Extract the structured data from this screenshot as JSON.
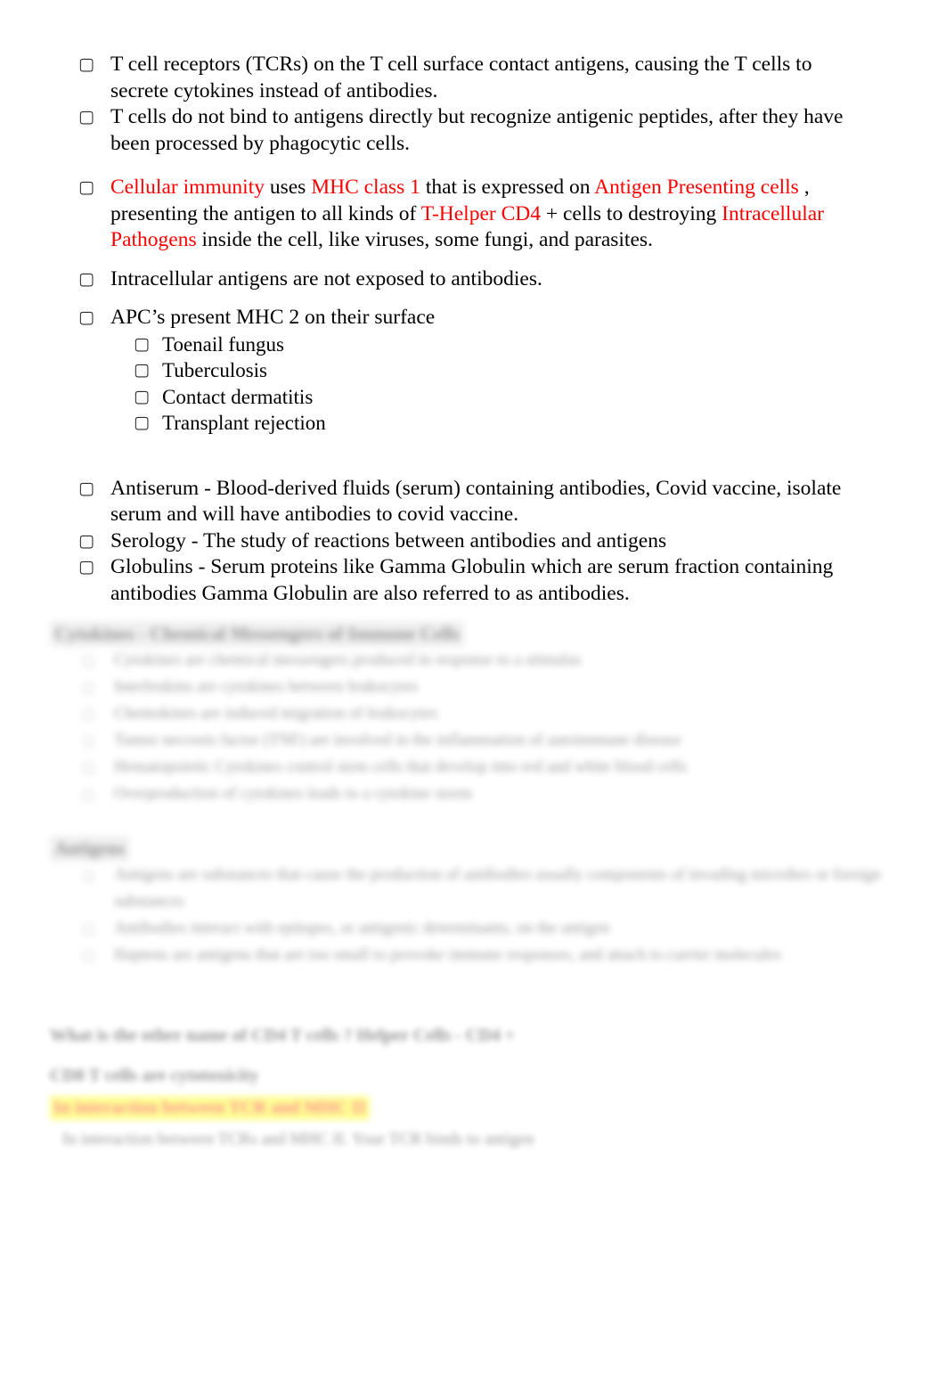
{
  "document": {
    "bullet_glyph": "▢",
    "colors": {
      "text": "#000000",
      "emphasis_red": "#ff0000",
      "highlight_yellow": "#ffff00",
      "heading_shade": "#d9d9d9"
    }
  },
  "clear_content": {
    "bullets": [
      {
        "id": "tcr-contact-antigens",
        "text": "T cell receptors (TCRs) on the T cell surface contact antigens, causing the T cells to secrete cytokines instead of antibodies."
      },
      {
        "id": "t-cells-recognize-peptides",
        "text": "T cells do not bind to antigens directly but recognize antigenic peptides, after they have been processed by phagocytic cells."
      }
    ],
    "cellular_immunity": {
      "seg1_red": "Cellular immunity",
      "seg2": "  uses ",
      "seg3_red": "MHC class 1",
      "seg4": "  that is expressed on ",
      "seg5_red": "Antigen Presenting cells",
      "seg6": "  , presenting the antigen to all kinds of ",
      "seg7_red": "T-Helper CD4",
      "seg8": "  + cells to destroying ",
      "seg9_red": "Intracellular Pathogens",
      "seg10": "  inside the cell, like viruses, some fungi, and parasites."
    },
    "intracellular_antigens": " Intracellular antigens are not exposed to antibodies.",
    "apc_heading": "APC’s present MHC 2 on their surface",
    "apc_examples": [
      "Toenail fungus",
      "Tuberculosis",
      "Contact dermatitis",
      "Transplant rejection"
    ],
    "definitions": [
      {
        "id": "antiserum",
        "text": "Antiserum - Blood-derived fluids (serum) containing antibodies, Covid vaccine, isolate serum and will have antibodies to covid vaccine."
      },
      {
        "id": "serology",
        "text": "Serology - The study of reactions between antibodies and antigens"
      },
      {
        "id": "globulins",
        "text": "Globulins - Serum proteins like Gamma Globulin which are serum fraction containing antibodies Gamma Globulin are also referred to as antibodies."
      }
    ]
  },
  "faded_content": {
    "cytokines_section": {
      "heading": "Cytokines - Chemical Messengers of Immune Cells",
      "bullets": [
        "Cytokines are chemical messengers produced in response to a stimulus",
        "Interleukins are cytokines between leukocytes",
        "Chemokines are induced migration of leukocytes",
        "Tumor necrosis factor (TNF) are involved in the inflammation of autoimmune disease",
        "Hematopoietic Cytokines control stem cells that develop into red and white blood cells",
        "Overproduction of cytokines leads to a cytokine storm"
      ]
    },
    "antigens_section": {
      "heading": "Antigens",
      "bullets": [
        "Antigens are substances that cause the production of antibodies usually components of invading microbes or foreign substances",
        "Antibodies interact with epitopes, or antigenic determinants, on the antigen",
        "Haptens are antigens that are too small to provoke immune responses, and attach to carrier molecules"
      ]
    },
    "question_block": {
      "line1": "What is the other name of CD4  T cells ? Helper Cells - CD4 +",
      "line2": "CD8  T cells are cytotoxicity",
      "highlight": "In interaction between TCR  and MHC II",
      "tail": "In interaction between TCRs and MHC II. Your TCR binds to antigen"
    }
  }
}
